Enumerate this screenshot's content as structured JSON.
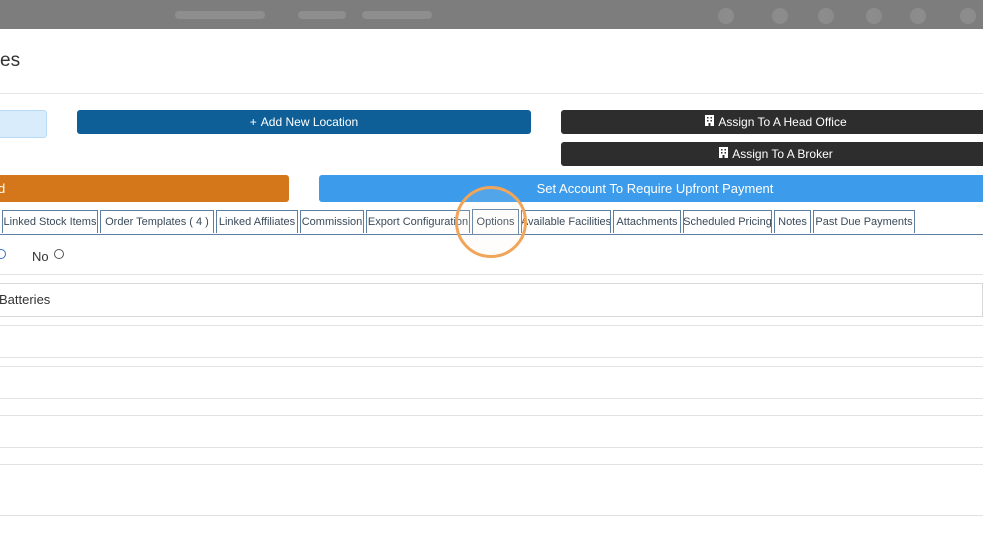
{
  "modal": {
    "title_partial": "es"
  },
  "buttons": {
    "add_new_location": "Add New Location",
    "assign_head_office": "Assign To A Head Office",
    "assign_broker": "Assign To A Broker",
    "orange_partial": "d",
    "set_upfront_payment": "Set Account To Require Upfront Payment"
  },
  "icons": {
    "add": "plus-icon",
    "building": "building-icon"
  },
  "tabs": [
    {
      "label": "Linked Stock Items"
    },
    {
      "label": "Order Templates ( 4 )"
    },
    {
      "label": "Linked Affiliates"
    },
    {
      "label": "Commission"
    },
    {
      "label": "Export Configuration"
    },
    {
      "label": "Options"
    },
    {
      "label": "Available Facilities"
    },
    {
      "label": "Attachments"
    },
    {
      "label": "Scheduled Pricing"
    },
    {
      "label": "Notes"
    },
    {
      "label": "Past Due Payments"
    }
  ],
  "active_tab": "Options",
  "options": {
    "no_label": "No",
    "batteries_partial": "Batteries"
  },
  "colors": {
    "primary_dark_blue": "#0e5f98",
    "dark": "#2d2d2d",
    "orange": "#d4771a",
    "light_blue": "#3c9beb",
    "highlight": "#f0a55a"
  }
}
